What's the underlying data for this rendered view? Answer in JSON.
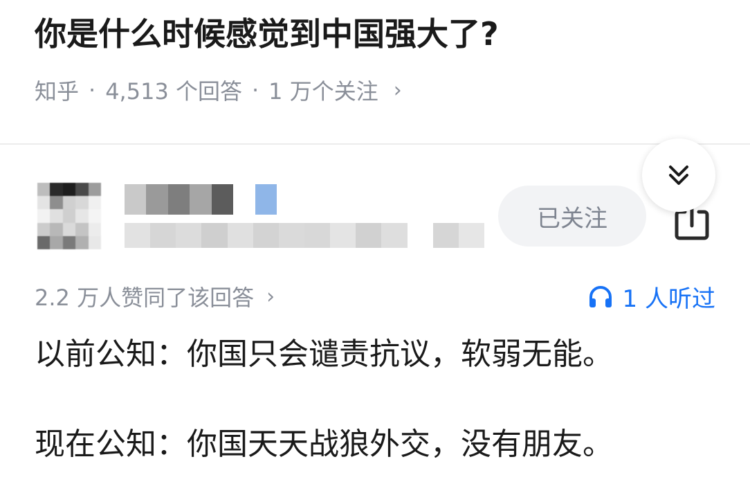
{
  "question": {
    "title": "你是什么时候感觉到中国强大了?",
    "source": "知乎",
    "separator": "·",
    "answers": "4,513 个回答",
    "followers": "1 万个关注",
    "chevron": "›"
  },
  "collapse_button": {
    "icon": "double-chevron-down-icon"
  },
  "author": {
    "follow_label": "已关注",
    "share_icon": "share-icon"
  },
  "answer": {
    "upvotes": "2.2 万人赞同了该回答",
    "chevron": "›",
    "listeners": "1 人听过",
    "listen_icon": "headphones-icon",
    "paragraphs": [
      "以前公知：你国只会谴责抗议，软弱无能。",
      "现在公知：你国天天战狼外交，没有朋友。"
    ]
  },
  "colors": {
    "text_primary": "#1a1a1a",
    "text_secondary": "#8a8f99",
    "accent_blue": "#1772f6",
    "follow_bg": "#f2f3f5"
  }
}
